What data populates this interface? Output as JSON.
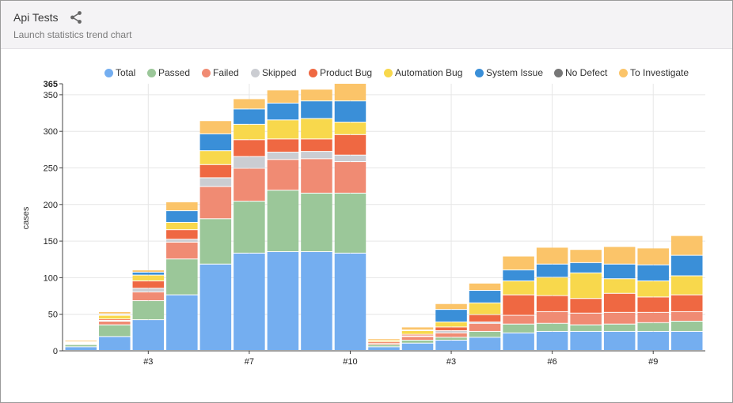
{
  "header": {
    "title": "Api Tests",
    "subtitle": "Launch statistics trend chart",
    "share_icon": "share-icon"
  },
  "colors": {
    "Total": "#74aef0",
    "Passed": "#9bc799",
    "Failed": "#f08b73",
    "Skipped": "#cbcdd2",
    "Product Bug": "#ef6842",
    "Automation Bug": "#f8d84c",
    "System Issue": "#3a8fd8",
    "No Defect": "#777777",
    "To Investigate": "#fbc469"
  },
  "legend": [
    "Total",
    "Passed",
    "Failed",
    "Skipped",
    "Product Bug",
    "Automation Bug",
    "System Issue",
    "No Defect",
    "To Investigate"
  ],
  "chart_data": {
    "type": "bar",
    "stacked": true,
    "ylabel": "cases",
    "ylim": [
      0,
      365
    ],
    "yticks": [
      0,
      50,
      100,
      150,
      200,
      250,
      300,
      350,
      365
    ],
    "grid": true,
    "legend_position": "top",
    "xtick_labels": [
      {
        "after_bar": 3,
        "label": "#3"
      },
      {
        "after_bar": 6,
        "label": "#7"
      },
      {
        "after_bar": 9,
        "label": "#10"
      },
      {
        "after_bar": 12,
        "label": "#3"
      },
      {
        "after_bar": 15,
        "label": "#6"
      },
      {
        "after_bar": 18,
        "label": "#9"
      }
    ],
    "series_order": [
      "Total",
      "Passed",
      "Failed",
      "Skipped",
      "Product Bug",
      "Automation Bug",
      "System Issue",
      "No Defect",
      "To Investigate"
    ],
    "series": [
      {
        "name": "Total",
        "values": [
          5,
          19,
          42,
          76,
          118,
          133,
          135,
          135,
          133,
          5,
          10,
          14,
          18,
          24,
          26,
          26,
          26,
          26,
          26
        ]
      },
      {
        "name": "Passed",
        "values": [
          3,
          16,
          26,
          49,
          62,
          71,
          84,
          80,
          82,
          3,
          4,
          4,
          8,
          12,
          11,
          9,
          10,
          12,
          14
        ]
      },
      {
        "name": "Failed",
        "values": [
          1,
          5,
          12,
          23,
          44,
          45,
          42,
          47,
          43,
          2,
          5,
          6,
          11,
          12,
          16,
          16,
          16,
          14,
          13
        ]
      },
      {
        "name": "Skipped",
        "values": [
          0,
          1,
          5,
          4,
          12,
          16,
          10,
          10,
          9,
          0,
          1,
          3,
          2,
          0,
          0,
          0,
          0,
          0,
          0
        ]
      },
      {
        "name": "Product Bug",
        "values": [
          1,
          2,
          10,
          13,
          18,
          23,
          18,
          17,
          28,
          2,
          2,
          5,
          10,
          28,
          22,
          20,
          26,
          21,
          23
        ]
      },
      {
        "name": "Automation Bug",
        "values": [
          1,
          5,
          8,
          10,
          19,
          21,
          26,
          28,
          17,
          2,
          5,
          7,
          16,
          19,
          25,
          35,
          20,
          22,
          26
        ]
      },
      {
        "name": "System Issue",
        "values": [
          0,
          1,
          4,
          16,
          23,
          21,
          23,
          24,
          29,
          0,
          1,
          17,
          17,
          15,
          18,
          14,
          20,
          22,
          28
        ]
      },
      {
        "name": "No Defect",
        "values": [
          1,
          1,
          0,
          0,
          0,
          0,
          0,
          0,
          0,
          0,
          0,
          0,
          0,
          0,
          0,
          0,
          0,
          0,
          0
        ]
      },
      {
        "name": "To Investigate",
        "values": [
          2,
          3,
          3,
          12,
          18,
          14,
          18,
          16,
          24,
          2,
          4,
          8,
          10,
          19,
          23,
          18,
          24,
          23,
          27
        ]
      }
    ]
  }
}
